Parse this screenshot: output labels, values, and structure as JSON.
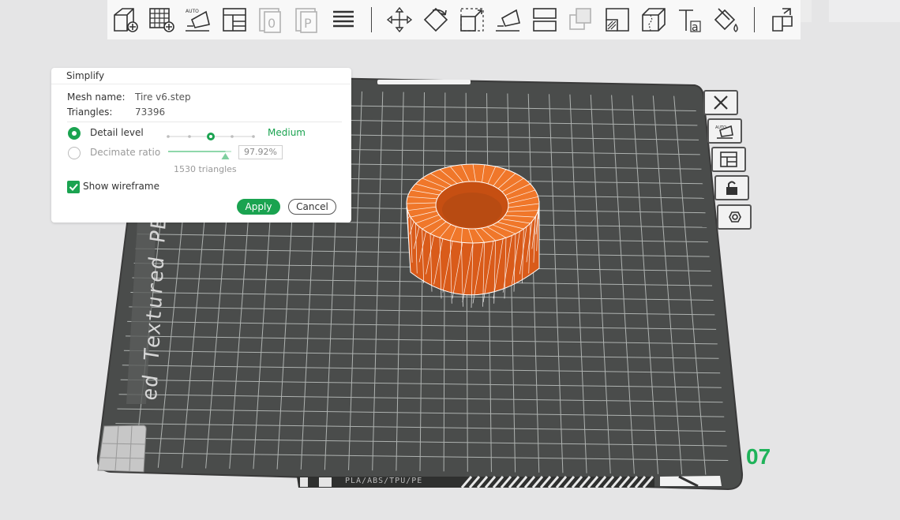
{
  "toolbar": {
    "buttons": [
      {
        "icon": "add-cube-icon"
      },
      {
        "icon": "add-plate-icon"
      },
      {
        "icon": "auto-orient-icon"
      },
      {
        "icon": "arrange-icon"
      },
      {
        "icon": "slice-plate-icon",
        "dimmed": true
      },
      {
        "icon": "print-plate-icon",
        "dimmed": true
      },
      {
        "icon": "layers-icon"
      },
      {
        "icon": "move-icon"
      },
      {
        "icon": "rotate-icon"
      },
      {
        "icon": "scale-icon"
      },
      {
        "icon": "lay-on-face-icon"
      },
      {
        "icon": "cut-icon"
      },
      {
        "icon": "boolean-icon",
        "dimmed": true
      },
      {
        "icon": "support-paint-icon"
      },
      {
        "icon": "seam-paint-icon"
      },
      {
        "icon": "text-icon"
      },
      {
        "icon": "color-paint-icon"
      },
      {
        "icon": "assembly-icon"
      }
    ],
    "auto_badge": "AUTO"
  },
  "plate": {
    "label": "ed Textured PEI Plate",
    "number": "07",
    "strip_text": "PLA/ABS/TPU/PE"
  },
  "plate_controls": [
    {
      "icon": "close-x-icon"
    },
    {
      "icon": "auto-orient-plate-icon"
    },
    {
      "icon": "arrange-plate-icon"
    },
    {
      "icon": "lock-icon"
    },
    {
      "icon": "plate-settings-icon"
    }
  ],
  "simplify": {
    "title": "Simplify",
    "mesh_name_label": "Mesh name:",
    "mesh_name": "Tire v6.step",
    "triangles_label": "Triangles:",
    "triangles": "73396",
    "detail_level_label": "Detail level",
    "detail_level_value": "Medium",
    "detail_level_steps": 5,
    "detail_level_index": 2,
    "decimate_label": "Decimate ratio",
    "decimate_ratio": "97.92%",
    "decimate_fraction": 0.9792,
    "result_triangles": "1530 triangles",
    "show_wireframe_label": "Show wireframe",
    "show_wireframe": true,
    "apply_label": "Apply",
    "cancel_label": "Cancel"
  },
  "colors": {
    "accent": "#1aa350",
    "plate": "#4a4c4b",
    "model": "#e0601e",
    "number": "#1fb35a"
  }
}
